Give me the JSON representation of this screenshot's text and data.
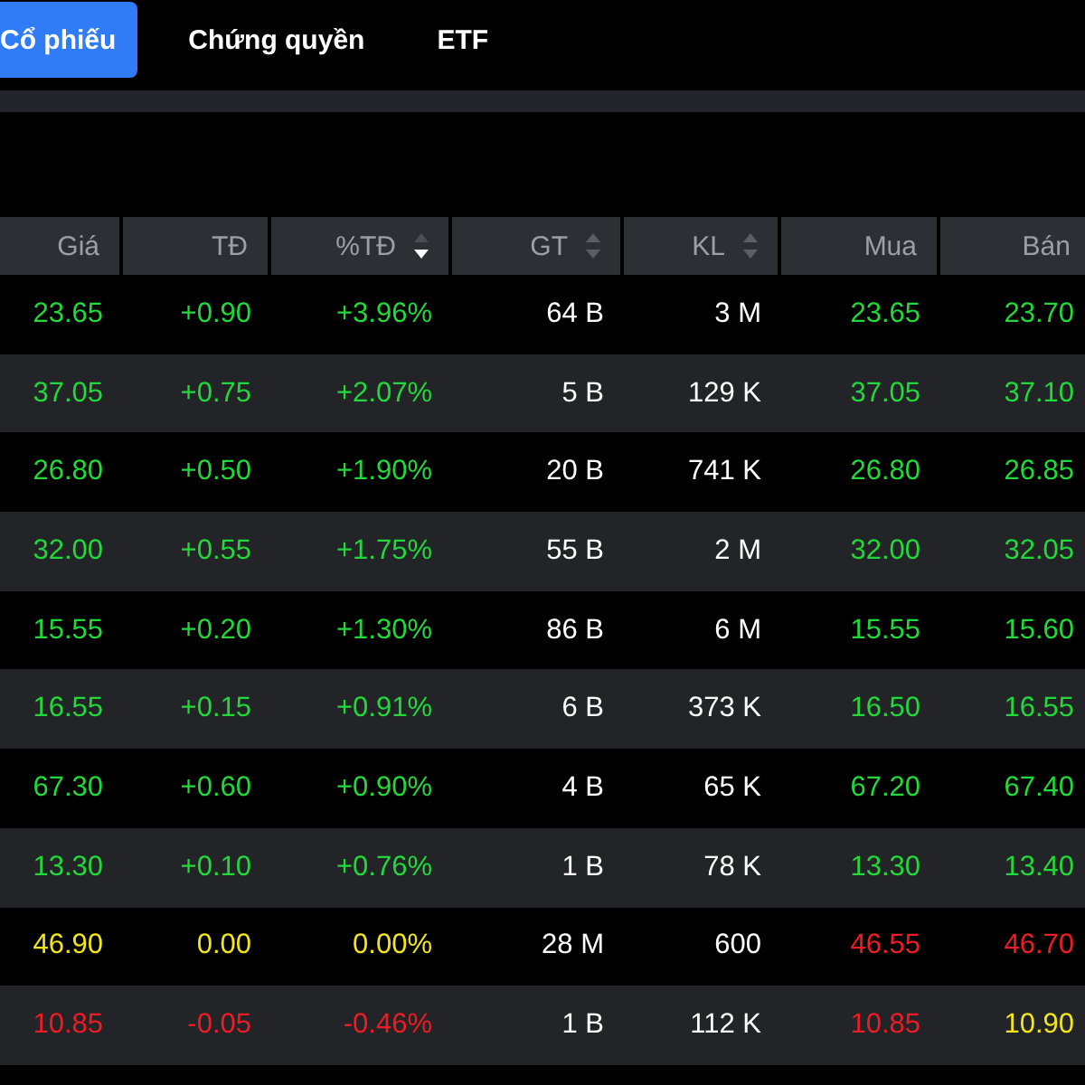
{
  "tabs": [
    {
      "label": "Cổ phiếu",
      "selected": true
    },
    {
      "label": "Chứng quyền",
      "selected": false
    },
    {
      "label": "ETF",
      "selected": false
    }
  ],
  "table": {
    "columns": [
      {
        "label": "Giá",
        "sortable": false
      },
      {
        "label": "TĐ",
        "sortable": false
      },
      {
        "label": "%TĐ",
        "sortable": true,
        "sorted_descending": true
      },
      {
        "label": "GT",
        "sortable": true,
        "sorted_descending": false
      },
      {
        "label": "KL",
        "sortable": true,
        "sorted_descending": false
      },
      {
        "label": "Mua",
        "sortable": false
      },
      {
        "label": "Bán",
        "sortable": false
      }
    ],
    "rows": [
      [
        {
          "text": "23.65",
          "color": "#22d83a"
        },
        {
          "text": "+0.90",
          "color": "#22d83a"
        },
        {
          "text": "+3.96%",
          "color": "#22d83a"
        },
        {
          "text": "64 B",
          "color": "#ffffff"
        },
        {
          "text": "3 M",
          "color": "#ffffff"
        },
        {
          "text": "23.65",
          "color": "#22d83a"
        },
        {
          "text": "23.70",
          "color": "#22d83a"
        }
      ],
      [
        {
          "text": "37.05",
          "color": "#22d83a"
        },
        {
          "text": "+0.75",
          "color": "#22d83a"
        },
        {
          "text": "+2.07%",
          "color": "#22d83a"
        },
        {
          "text": "5 B",
          "color": "#ffffff"
        },
        {
          "text": "129 K",
          "color": "#ffffff"
        },
        {
          "text": "37.05",
          "color": "#22d83a"
        },
        {
          "text": "37.10",
          "color": "#22d83a"
        }
      ],
      [
        {
          "text": "26.80",
          "color": "#22d83a"
        },
        {
          "text": "+0.50",
          "color": "#22d83a"
        },
        {
          "text": "+1.90%",
          "color": "#22d83a"
        },
        {
          "text": "20 B",
          "color": "#ffffff"
        },
        {
          "text": "741 K",
          "color": "#ffffff"
        },
        {
          "text": "26.80",
          "color": "#22d83a"
        },
        {
          "text": "26.85",
          "color": "#22d83a"
        }
      ],
      [
        {
          "text": "32.00",
          "color": "#22d83a"
        },
        {
          "text": "+0.55",
          "color": "#22d83a"
        },
        {
          "text": "+1.75%",
          "color": "#22d83a"
        },
        {
          "text": "55 B",
          "color": "#ffffff"
        },
        {
          "text": "2 M",
          "color": "#ffffff"
        },
        {
          "text": "32.00",
          "color": "#22d83a"
        },
        {
          "text": "32.05",
          "color": "#22d83a"
        }
      ],
      [
        {
          "text": "15.55",
          "color": "#22d83a"
        },
        {
          "text": "+0.20",
          "color": "#22d83a"
        },
        {
          "text": "+1.30%",
          "color": "#22d83a"
        },
        {
          "text": "86 B",
          "color": "#ffffff"
        },
        {
          "text": "6 M",
          "color": "#ffffff"
        },
        {
          "text": "15.55",
          "color": "#22d83a"
        },
        {
          "text": "15.60",
          "color": "#22d83a"
        }
      ],
      [
        {
          "text": "16.55",
          "color": "#22d83a"
        },
        {
          "text": "+0.15",
          "color": "#22d83a"
        },
        {
          "text": "+0.91%",
          "color": "#22d83a"
        },
        {
          "text": "6 B",
          "color": "#ffffff"
        },
        {
          "text": "373 K",
          "color": "#ffffff"
        },
        {
          "text": "16.50",
          "color": "#22d83a"
        },
        {
          "text": "16.55",
          "color": "#22d83a"
        }
      ],
      [
        {
          "text": "67.30",
          "color": "#22d83a"
        },
        {
          "text": "+0.60",
          "color": "#22d83a"
        },
        {
          "text": "+0.90%",
          "color": "#22d83a"
        },
        {
          "text": "4 B",
          "color": "#ffffff"
        },
        {
          "text": "65 K",
          "color": "#ffffff"
        },
        {
          "text": "67.20",
          "color": "#22d83a"
        },
        {
          "text": "67.40",
          "color": "#22d83a"
        }
      ],
      [
        {
          "text": "13.30",
          "color": "#22d83a"
        },
        {
          "text": "+0.10",
          "color": "#22d83a"
        },
        {
          "text": "+0.76%",
          "color": "#22d83a"
        },
        {
          "text": "1 B",
          "color": "#ffffff"
        },
        {
          "text": "78 K",
          "color": "#ffffff"
        },
        {
          "text": "13.30",
          "color": "#22d83a"
        },
        {
          "text": "13.40",
          "color": "#22d83a"
        }
      ],
      [
        {
          "text": "46.90",
          "color": "#f2e51c"
        },
        {
          "text": "0.00",
          "color": "#f2e51c"
        },
        {
          "text": "0.00%",
          "color": "#f2e51c"
        },
        {
          "text": "28 M",
          "color": "#ffffff"
        },
        {
          "text": "600",
          "color": "#ffffff"
        },
        {
          "text": "46.55",
          "color": "#ee1c25"
        },
        {
          "text": "46.70",
          "color": "#ee1c25"
        }
      ],
      [
        {
          "text": "10.85",
          "color": "#ee1c25"
        },
        {
          "text": "-0.05",
          "color": "#ee1c25"
        },
        {
          "text": "-0.46%",
          "color": "#ee1c25"
        },
        {
          "text": "1 B",
          "color": "#ffffff"
        },
        {
          "text": "112 K",
          "color": "#ffffff"
        },
        {
          "text": "10.85",
          "color": "#ee1c25"
        },
        {
          "text": "10.90",
          "color": "#f2e51c"
        }
      ]
    ]
  }
}
